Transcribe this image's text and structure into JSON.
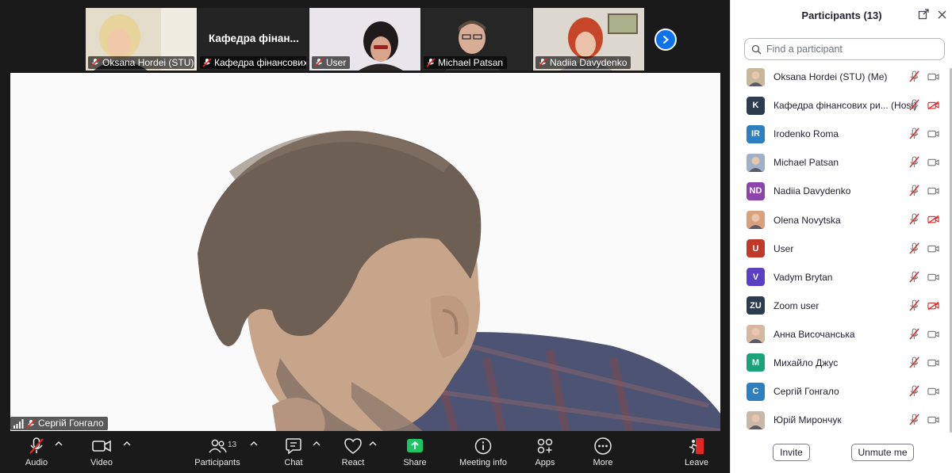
{
  "thumbnails": [
    {
      "name": "Oksana Hordei (STU)",
      "kind": "video"
    },
    {
      "name": "Кафедра фінансових...",
      "kind": "title",
      "title": "Кафедра фінан..."
    },
    {
      "name": "User",
      "kind": "video"
    },
    {
      "name": "Michael Patsan",
      "kind": "video"
    },
    {
      "name": "Nadiia Davydenko",
      "kind": "video"
    }
  ],
  "main_video": {
    "speaker_name": "Сергій Гонгало"
  },
  "toolbar": {
    "audio": "Audio",
    "video": "Video",
    "participants": "Participants",
    "participants_count": "13",
    "chat": "Chat",
    "react": "React",
    "share": "Share",
    "meeting_info": "Meeting info",
    "apps": "Apps",
    "more": "More",
    "leave": "Leave"
  },
  "panel": {
    "title": "Participants (13)",
    "search_placeholder": "Find a participant",
    "invite": "Invite",
    "unmute_me": "Unmute me"
  },
  "participants": [
    {
      "name": "Oksana Hordei (STU) (Me)",
      "initials": "",
      "color": "#c9b79a",
      "photo": true,
      "cam_off": false
    },
    {
      "name": "Кафедра фінансових ри... (Host)",
      "initials": "K",
      "color": "#2d3b4e",
      "photo": false,
      "cam_off": true
    },
    {
      "name": "Irodenko Roma",
      "initials": "IR",
      "color": "#2e7fbf",
      "photo": false,
      "cam_off": false
    },
    {
      "name": "Michael Patsan",
      "initials": "",
      "color": "#9fb0c8",
      "photo": true,
      "cam_off": false
    },
    {
      "name": "Nadiia Davydenko",
      "initials": "ND",
      "color": "#8e44ad",
      "photo": false,
      "cam_off": false
    },
    {
      "name": "Olena Novytska",
      "initials": "",
      "color": "#d9a07a",
      "photo": true,
      "cam_off": true
    },
    {
      "name": "User",
      "initials": "U",
      "color": "#c0392b",
      "photo": false,
      "cam_off": false
    },
    {
      "name": "Vadym Brytan",
      "initials": "V",
      "color": "#5b3fc4",
      "photo": false,
      "cam_off": false
    },
    {
      "name": "Zoom user",
      "initials": "ZU",
      "color": "#2d3b4e",
      "photo": false,
      "cam_off": true
    },
    {
      "name": "Анна Височанська",
      "initials": "",
      "color": "#d8b7a0",
      "photo": true,
      "cam_off": false
    },
    {
      "name": "Михайло Джус",
      "initials": "M",
      "color": "#1aa37a",
      "photo": false,
      "cam_off": false
    },
    {
      "name": "Сергій Гонгало",
      "initials": "C",
      "color": "#2e7fbf",
      "photo": false,
      "cam_off": false
    },
    {
      "name": "Юрій Мирончук",
      "initials": "",
      "color": "#c9b8a8",
      "photo": true,
      "cam_off": false
    }
  ],
  "colors": {
    "accent": "#0e72ed",
    "share_green": "#1ec663",
    "muted_red": "#e02828",
    "leave_red": "#e02828"
  }
}
